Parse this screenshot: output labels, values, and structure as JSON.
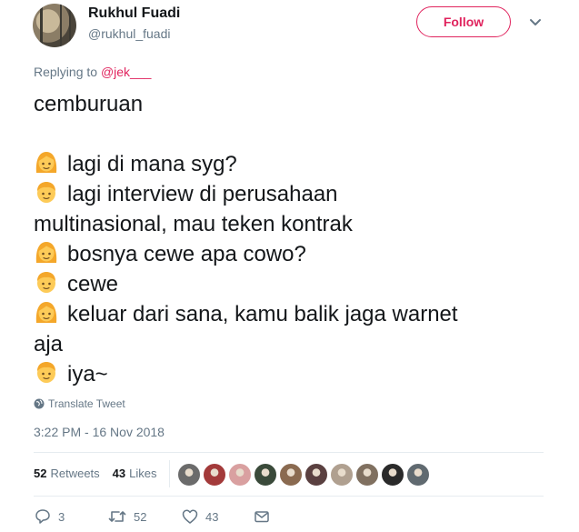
{
  "user": {
    "name": "Rukhul Fuadi",
    "handle": "@rukhul_fuadi"
  },
  "follow_label": "Follow",
  "replying": {
    "prefix": "Replying to",
    "to": "@jek___"
  },
  "tweet": {
    "first_line": "cemburuan",
    "lines": [
      {
        "speaker": "girl",
        "text": "lagi di mana syg?"
      },
      {
        "speaker": "boy",
        "text": "lagi interview di perusahaan"
      },
      {
        "speaker": "none",
        "text": "multinasional, mau teken kontrak"
      },
      {
        "speaker": "girl",
        "text": "bosnya cewe apa cowo?"
      },
      {
        "speaker": "boy",
        "text": "cewe"
      },
      {
        "speaker": "girl",
        "text": "keluar dari sana, kamu balik jaga warnet"
      },
      {
        "speaker": "none",
        "text": "aja"
      },
      {
        "speaker": "boy",
        "text": "iya~"
      }
    ]
  },
  "translate_label": "Translate Tweet",
  "timestamp": "3:22 PM - 16 Nov 2018",
  "stats": {
    "retweets_count": "52",
    "retweets_label": "Retweets",
    "likes_count": "43",
    "likes_label": "Likes"
  },
  "liker_avatars": [
    "#6b6b6b",
    "#a33a3a",
    "#d9a0a0",
    "#3a4a3a",
    "#8a6a50",
    "#5a4040",
    "#b0a090",
    "#807060",
    "#2a2a2a",
    "#606a70"
  ],
  "actions": {
    "reply_count": "3",
    "retweet_count": "52",
    "like_count": "43"
  },
  "colors": {
    "accent": "#e0245e",
    "muted": "#657786",
    "emoji_face": "#fdcb58",
    "emoji_hair": "#f4a72a"
  }
}
